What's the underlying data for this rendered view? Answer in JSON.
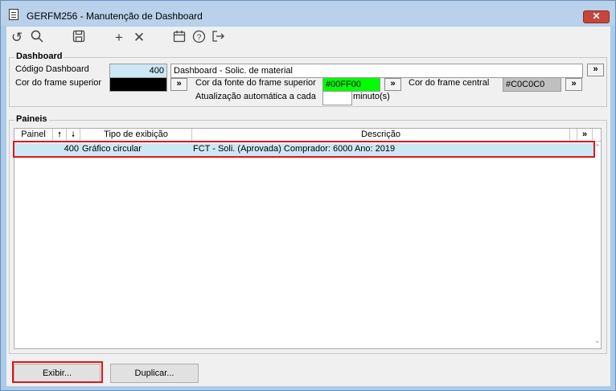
{
  "window": {
    "title": "GERFM256 - Manutenção de Dashboard",
    "close_label": "✕"
  },
  "toolbar": {
    "icons": [
      "refresh-icon",
      "search-icon",
      "save-icon",
      "add-icon",
      "delete-icon",
      "calendar-icon",
      "help-icon",
      "exit-icon"
    ]
  },
  "dashboard": {
    "group_title": "Dashboard",
    "codigo_label": "Código Dashboard",
    "codigo_value": "400",
    "descricao_value": "Dashboard - Solic. de material",
    "cor_frame_superior_label": "Cor do frame superior",
    "cor_frame_superior_value": "#000000",
    "cor_fonte_label": "Cor da fonte do frame superior",
    "cor_fonte_value": "#00FF00",
    "cor_frame_central_label": "Cor do frame central",
    "cor_frame_central_value": "#C0C0C0",
    "atualizacao_label": "Atualização automática a cada",
    "atualizacao_value": "",
    "minutos_label": "minuto(s)",
    "more_label": "»"
  },
  "paineis": {
    "group_title": "Paineis",
    "columns": {
      "painel": "Painel",
      "up": "🠕",
      "down": "🠗",
      "tipo": "Tipo de exibição",
      "descricao": "Descrição",
      "more": "»"
    },
    "rows": [
      {
        "painel": "400",
        "tipo": "Gráfico circular",
        "descricao": "FCT - Soli. (Aprovada) Comprador: 6000 Ano: 2019"
      }
    ]
  },
  "buttons": {
    "exibir": "Exibir...",
    "duplicar": "Duplicar..."
  },
  "colors": {
    "highlight": "#e0151d",
    "selected_row": "#cce8f4",
    "codigo_bg": "#cce8f4",
    "green": "#00ff00",
    "silver": "#c0c0c0"
  }
}
